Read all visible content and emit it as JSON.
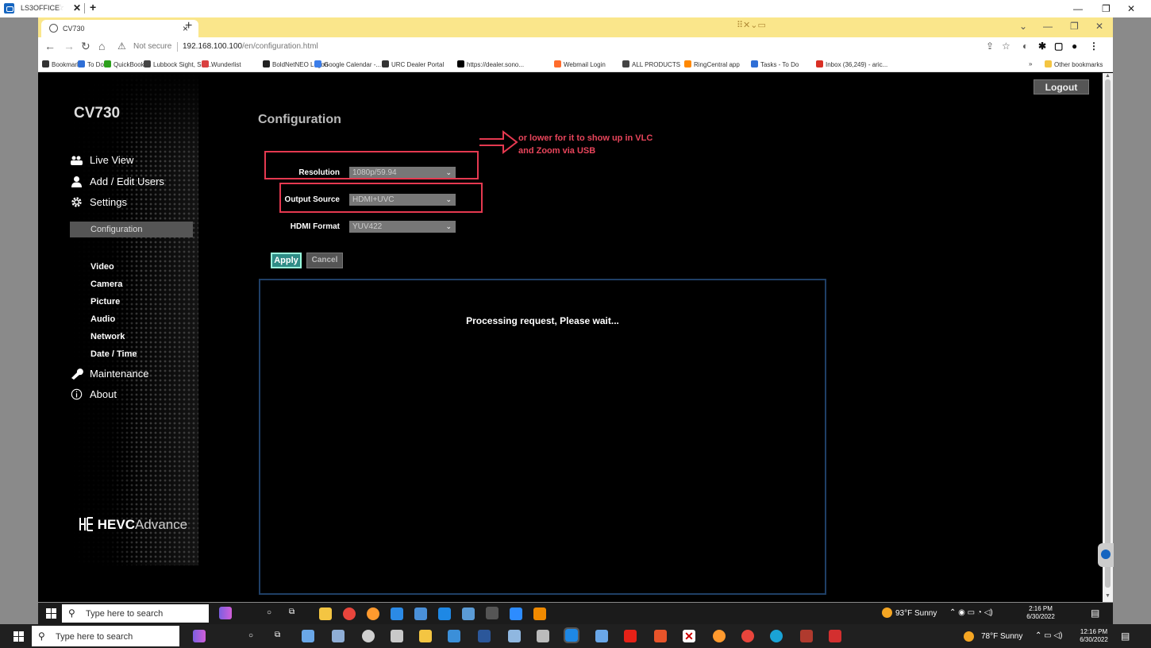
{
  "outer_window": {
    "title": "LS3OFFICE",
    "close_tab_label": "✕",
    "new_tab_label": "+"
  },
  "browser": {
    "tab_title": "CV730",
    "tab_close": "×",
    "new_tab": "+",
    "security_label": "Not secure",
    "url_host": "192.168.100.100",
    "url_path": "/en/configuration.html",
    "bookmarks": [
      {
        "label": "Bookmarks",
        "icon": "star-icon",
        "color": "#333333"
      },
      {
        "label": "To Do",
        "icon": "check-icon",
        "color": "#2f6fd6"
      },
      {
        "label": "QuickBooks",
        "icon": "quickbooks-icon",
        "color": "#2ca01c"
      },
      {
        "label": "Lubbock Sight, Sou...",
        "icon": "globe-icon",
        "color": "#444444"
      },
      {
        "label": "Wunderlist",
        "icon": "wunderlist-icon",
        "color": "#d94040"
      },
      {
        "label": "BoldNetNEO Logon",
        "icon": "n-icon",
        "color": "#222222"
      },
      {
        "label": "Google Calendar -...",
        "icon": "calendar-icon",
        "color": "#3b7de9"
      },
      {
        "label": "URC Dealer Portal",
        "icon": "urc-icon",
        "color": "#333333"
      },
      {
        "label": "https://dealer.sono...",
        "icon": "sonos-icon",
        "color": "#000000"
      },
      {
        "label": "Webmail Login",
        "icon": "cpanel-icon",
        "color": "#ff6c2c"
      },
      {
        "label": "ALL PRODUCTS",
        "icon": "globe-icon",
        "color": "#444444"
      },
      {
        "label": "RingCentral app",
        "icon": "ringcentral-icon",
        "color": "#ff8800"
      },
      {
        "label": "Tasks - To Do",
        "icon": "check-icon",
        "color": "#2f6fd6"
      },
      {
        "label": "Inbox (36,249) - aric...",
        "icon": "gmail-icon",
        "color": "#d93025"
      }
    ],
    "bookmarks_more": "»",
    "other_bookmarks": "Other bookmarks"
  },
  "page": {
    "logout_label": "Logout",
    "device_model": "CV730",
    "nav": [
      {
        "label": "Live View",
        "icon": "live-view-icon"
      },
      {
        "label": "Add / Edit Users",
        "icon": "user-icon"
      },
      {
        "label": "Settings",
        "icon": "gear-icon"
      }
    ],
    "settings_sub": [
      "Configuration",
      "Video",
      "Camera",
      "Picture",
      "Audio",
      "Network",
      "Date / Time"
    ],
    "nav_bottom": [
      {
        "label": "Maintenance",
        "icon": "wrench-icon"
      },
      {
        "label": "About",
        "icon": "info-icon"
      }
    ],
    "brand_logo_text": "HEVCAdvance",
    "brand_bold": "HEVC",
    "brand_thin": "Advance",
    "config_title": "Configuration",
    "fields": [
      {
        "label": "Resolution",
        "value": "1080p/59.94"
      },
      {
        "label": "Output Source",
        "value": "HDMI+UVC"
      },
      {
        "label": "HDMI Format",
        "value": "YUV422"
      }
    ],
    "apply_label": "Apply",
    "cancel_label": "Cancel",
    "processing_message": "Processing request, Please wait...",
    "annotation_note": "or lower for it to show up in VLC and Zoom via USB",
    "annotation_color": "#e53950"
  },
  "taskbar_inner": {
    "search_placeholder": "Type here to search",
    "weather": "93°F Sunny",
    "time": "2:16 PM",
    "date": "6/30/2022"
  },
  "taskbar_outer": {
    "search_placeholder": "Type here to search",
    "weather": "78°F Sunny",
    "time": "12:16 PM",
    "date": "6/30/2022"
  }
}
